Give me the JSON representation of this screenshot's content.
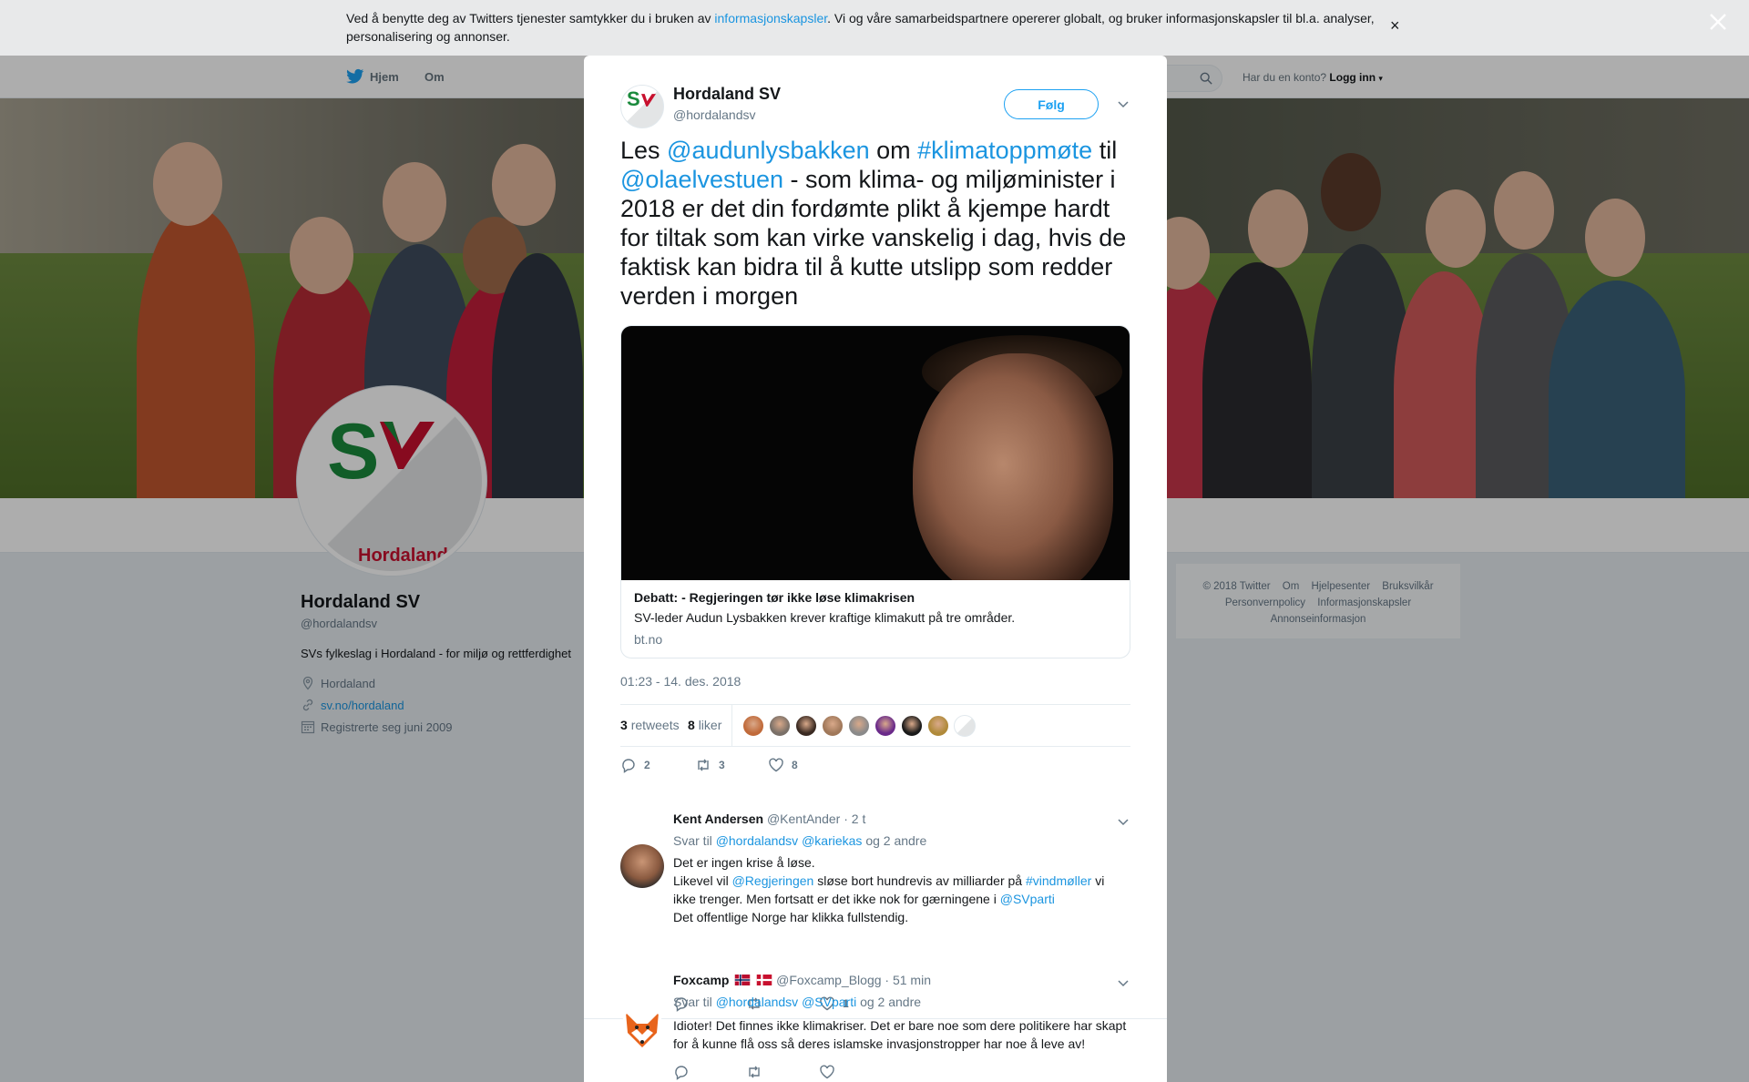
{
  "cookie_bar": {
    "text_before": "Ved å benytte deg av Twitters tjenester samtykker du i bruken av ",
    "link": "informasjonskapsler",
    "text_after": ". Vi og våre samarbeidspartnere opererer globalt, og bruker informasjonskapsler til bl.a. analyser, personalisering og annonser.",
    "close": "×"
  },
  "topnav": {
    "home": "Hjem",
    "about": "Om",
    "login_question": "Har du en konto?",
    "login": "Logg inn"
  },
  "profile": {
    "name": "Hordaland SV",
    "handle": "@hordalandsv",
    "bio": "SVs fylkeslag i Hordaland - for miljø og rettferdighet",
    "location": "Hordaland",
    "website": "sv.no/hordaland",
    "joined": "Registrerte seg juni 2009",
    "avatar_logo_text": "Hordaland"
  },
  "footer_box": {
    "items": [
      "© 2018 Twitter",
      "Om",
      "Hjelpesenter",
      "Bruksvilkår",
      "Personvernpolicy",
      "Informasjonskapsler",
      "Annonseinformasjon"
    ]
  },
  "tweet": {
    "author_name": "Hordaland SV",
    "author_handle": "@hordalandsv",
    "follow_label": "Følg",
    "text_parts": {
      "p1": "Les ",
      "m1": "@audunlysbakken",
      "p2": " om ",
      "h1": "#klimatoppmøte",
      "p3": " til ",
      "m2": "@olaelvestuen",
      "p4": " - som klima- og miljøminister i 2018 er det din fordømte plikt å kjempe hardt for tiltak som kan virke vanskelig i dag, hvis de faktisk kan bidra til å kutte utslipp som redder verden i morgen"
    },
    "card": {
      "title": "Debatt: - Regjeringen tør ikke løse klimakrisen",
      "description": "SV-leder Audun Lysbakken krever kraftige klimakutt på tre områder.",
      "domain": "bt.no"
    },
    "timestamp": "01:23 - 14. des. 2018",
    "retweets_count": "3",
    "retweets_label": "retweets",
    "likes_count": "8",
    "likes_label": "liker",
    "liker_avatar_colors": [
      "#c06a3a",
      "#7a7068",
      "#3a2a22",
      "#a0785a",
      "#8a8a8a",
      "#6a2a8a",
      "#1a1a1a",
      "#b08a3a",
      "#ffffff"
    ],
    "actions": {
      "replies": "2",
      "retweets": "3",
      "likes": "8"
    }
  },
  "replies": [
    {
      "name": "Kent Andersen",
      "handle": "@KentAnder",
      "time": "· 2 t",
      "reply_prefix": "Svar til",
      "reply_to_1": "@hordalandsv",
      "reply_to_2": "@kariekas",
      "reply_suffix": "og 2 andre",
      "line1": "Det er ingen krise å løse.",
      "line2_a": "Likevel vil ",
      "line2_m": "@Regjeringen",
      "line2_b": " sløse bort hundrevis av milliarder på ",
      "line2_h": "#vindmøller",
      "line2_c": " vi ikke trenger. Men fortsatt er det ikke nok for gærningene i ",
      "line2_m2": "@SVparti",
      "line3": "Det offentlige Norge har klikka fullstendig.",
      "actions": {
        "replies": "",
        "retweets": "",
        "likes": "1"
      }
    },
    {
      "name": "Foxcamp",
      "handle": "@Foxcamp_Blogg",
      "time": "· 51 min",
      "reply_prefix": "Svar til",
      "reply_to_1": "@hordalandsv",
      "reply_to_2": "@SVparti",
      "reply_suffix": "og 2 andre",
      "text": "Idioter! Det finnes ikke klimakriser. Det er bare noe som dere politikere har skapt for å kunne flå oss så deres islamske invasjonstropper har noe å leve av!",
      "actions": {
        "replies": "",
        "retweets": "",
        "likes": ""
      }
    }
  ],
  "colors": {
    "accent": "#1da1f2",
    "link": "#1b95e0",
    "sv_green": "#1a8a3c",
    "sv_red": "#c8102e"
  }
}
